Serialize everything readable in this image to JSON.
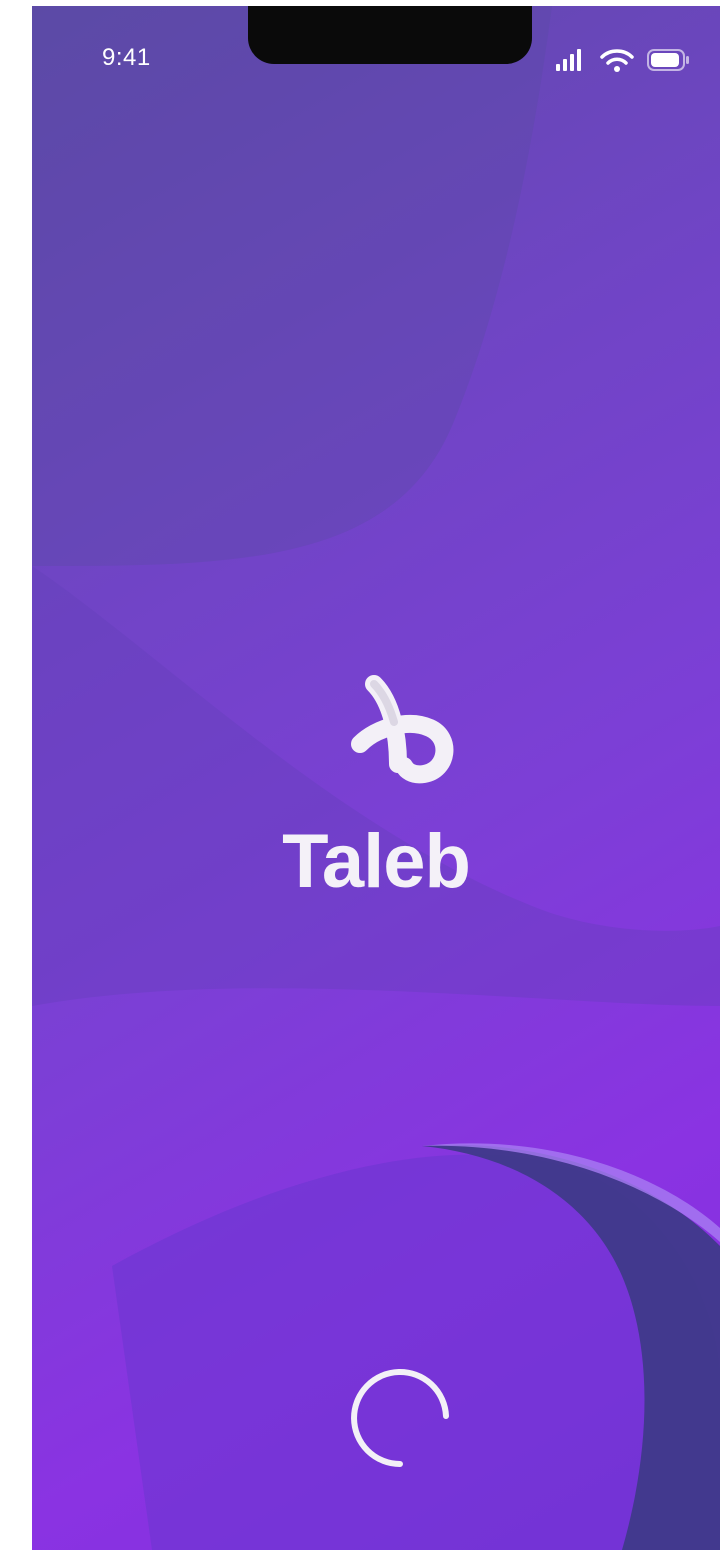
{
  "status_bar": {
    "time": "9:41",
    "icons": [
      "signal-icon",
      "wifi-icon",
      "battery-icon"
    ]
  },
  "brand": {
    "name": "Taleb",
    "logo_icon": "taleb-logo-icon"
  },
  "loading": {
    "indicator_icon": "loading-spinner-icon"
  },
  "colors": {
    "background_start": "#5e4aa8",
    "background_end": "#8a33e2",
    "text": "#f4f1f8",
    "accent_dark": "#3f3a8a"
  }
}
